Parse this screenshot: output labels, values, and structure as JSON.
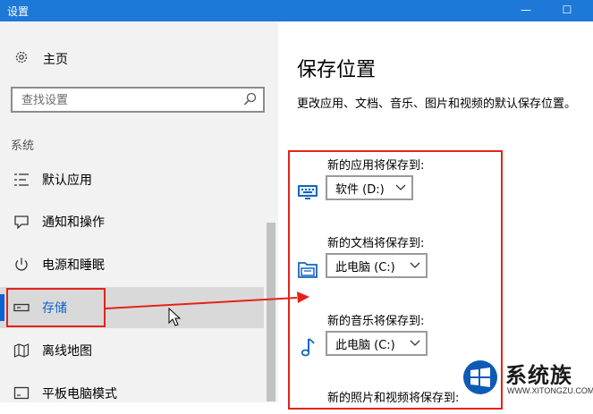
{
  "window": {
    "title": "设置",
    "min_glyph": "—",
    "max_glyph": "☐"
  },
  "sidebar": {
    "home_label": "主页",
    "search_placeholder": "查找设置",
    "section": "系统",
    "items": [
      {
        "label": "默认应用",
        "icon": "default-apps-icon"
      },
      {
        "label": "通知和操作",
        "icon": "notifications-icon"
      },
      {
        "label": "电源和睡眠",
        "icon": "power-icon"
      },
      {
        "label": "存储",
        "icon": "storage-icon",
        "active": true
      },
      {
        "label": "离线地图",
        "icon": "map-icon"
      },
      {
        "label": "平板电脑模式",
        "icon": "tablet-icon"
      }
    ]
  },
  "main": {
    "heading": "保存位置",
    "description": "更改应用、文档、音乐、图片和视频的默认保存位置。",
    "groups": [
      {
        "label": "新的应用将保存到:",
        "value": "软件 (D:)",
        "icon": "monitor-icon"
      },
      {
        "label": "新的文档将保存到:",
        "value": "此电脑 (C:)",
        "icon": "folder-icon"
      },
      {
        "label": "新的音乐将保存到:",
        "value": "此电脑 (C:)",
        "icon": "music-note-icon"
      },
      {
        "label": "新的照片和视频将保存到:",
        "icon": "photo-icon"
      }
    ]
  },
  "colors": {
    "accent": "#0a64d2",
    "annotation": "#e2231a",
    "titlebar": "#1e78d7"
  },
  "watermark": {
    "text": "系统族",
    "url": "WWW.XITONGZU.COM"
  }
}
